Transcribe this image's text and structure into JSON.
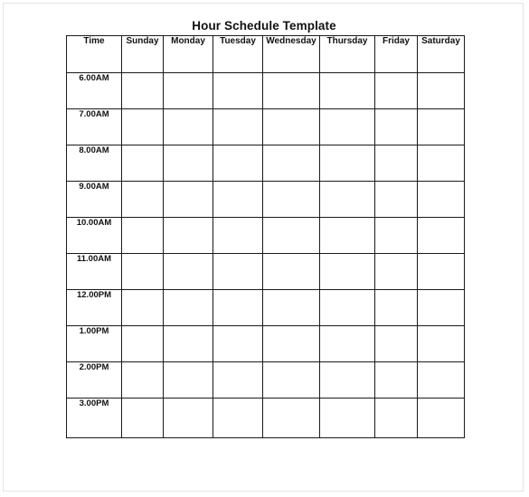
{
  "document": {
    "title": "Hour Schedule Template"
  },
  "table": {
    "columns": [
      "Time",
      "Sunday",
      "Monday",
      "Tuesday",
      "Wednesday",
      "Thursday",
      "Friday",
      "Saturday"
    ],
    "rows": [
      {
        "time": "6.00AM",
        "cells": [
          "",
          "",
          "",
          "",
          "",
          "",
          ""
        ]
      },
      {
        "time": "7.00AM",
        "cells": [
          "",
          "",
          "",
          "",
          "",
          "",
          ""
        ]
      },
      {
        "time": "8.00AM",
        "cells": [
          "",
          "",
          "",
          "",
          "",
          "",
          ""
        ]
      },
      {
        "time": "9.00AM",
        "cells": [
          "",
          "",
          "",
          "",
          "",
          "",
          ""
        ]
      },
      {
        "time": "10.00AM",
        "cells": [
          "",
          "",
          "",
          "",
          "",
          "",
          ""
        ]
      },
      {
        "time": "11.00AM",
        "cells": [
          "",
          "",
          "",
          "",
          "",
          "",
          ""
        ]
      },
      {
        "time": "12.00PM",
        "cells": [
          "",
          "",
          "",
          "",
          "",
          "",
          ""
        ]
      },
      {
        "time": "1.00PM",
        "cells": [
          "",
          "",
          "",
          "",
          "",
          "",
          ""
        ]
      },
      {
        "time": "2.00PM",
        "cells": [
          "",
          "",
          "",
          "",
          "",
          "",
          ""
        ]
      },
      {
        "time": "3.00PM",
        "cells": [
          "",
          "",
          "",
          "",
          "",
          "",
          ""
        ]
      }
    ]
  },
  "colors": {
    "grid_line": "#1a1a1a",
    "text": "#111111",
    "page_border": "#e3e3e3",
    "background": "#ffffff"
  }
}
